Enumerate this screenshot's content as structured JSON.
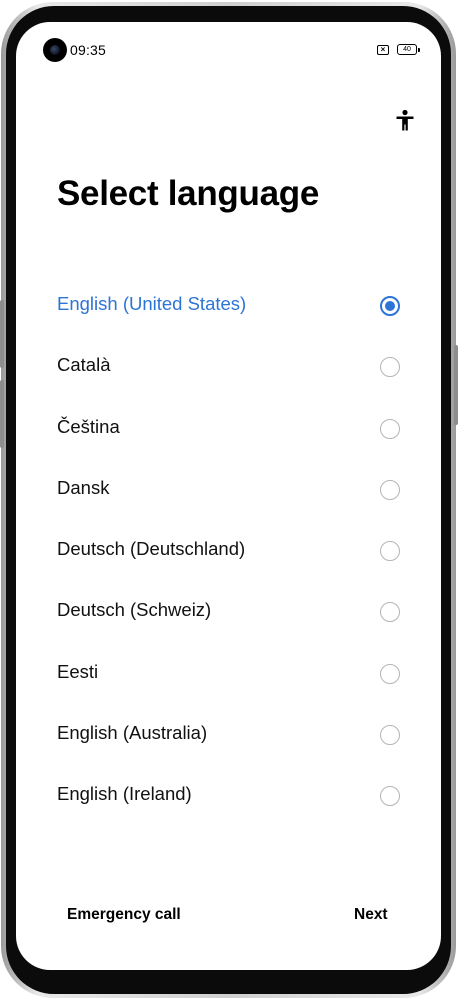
{
  "status_bar": {
    "time": "09:35",
    "sim_status_icon": "sim-off-icon",
    "battery_level": "40"
  },
  "header": {
    "accessibility_icon": "accessibility-icon",
    "title": "Select language"
  },
  "languages": {
    "selected_index": 0,
    "items": [
      {
        "label": "English (United States)",
        "selected": true
      },
      {
        "label": "Català",
        "selected": false
      },
      {
        "label": "Čeština",
        "selected": false
      },
      {
        "label": "Dansk",
        "selected": false
      },
      {
        "label": "Deutsch (Deutschland)",
        "selected": false
      },
      {
        "label": "Deutsch (Schweiz)",
        "selected": false
      },
      {
        "label": "Eesti",
        "selected": false
      },
      {
        "label": "English (Australia)",
        "selected": false
      },
      {
        "label": "English (Ireland)",
        "selected": false
      }
    ]
  },
  "footer": {
    "emergency_label": "Emergency call",
    "next_label": "Next"
  },
  "colors": {
    "accent": "#2c74d6",
    "text": "#111111",
    "radio_unselected": "#b5b5b5"
  }
}
